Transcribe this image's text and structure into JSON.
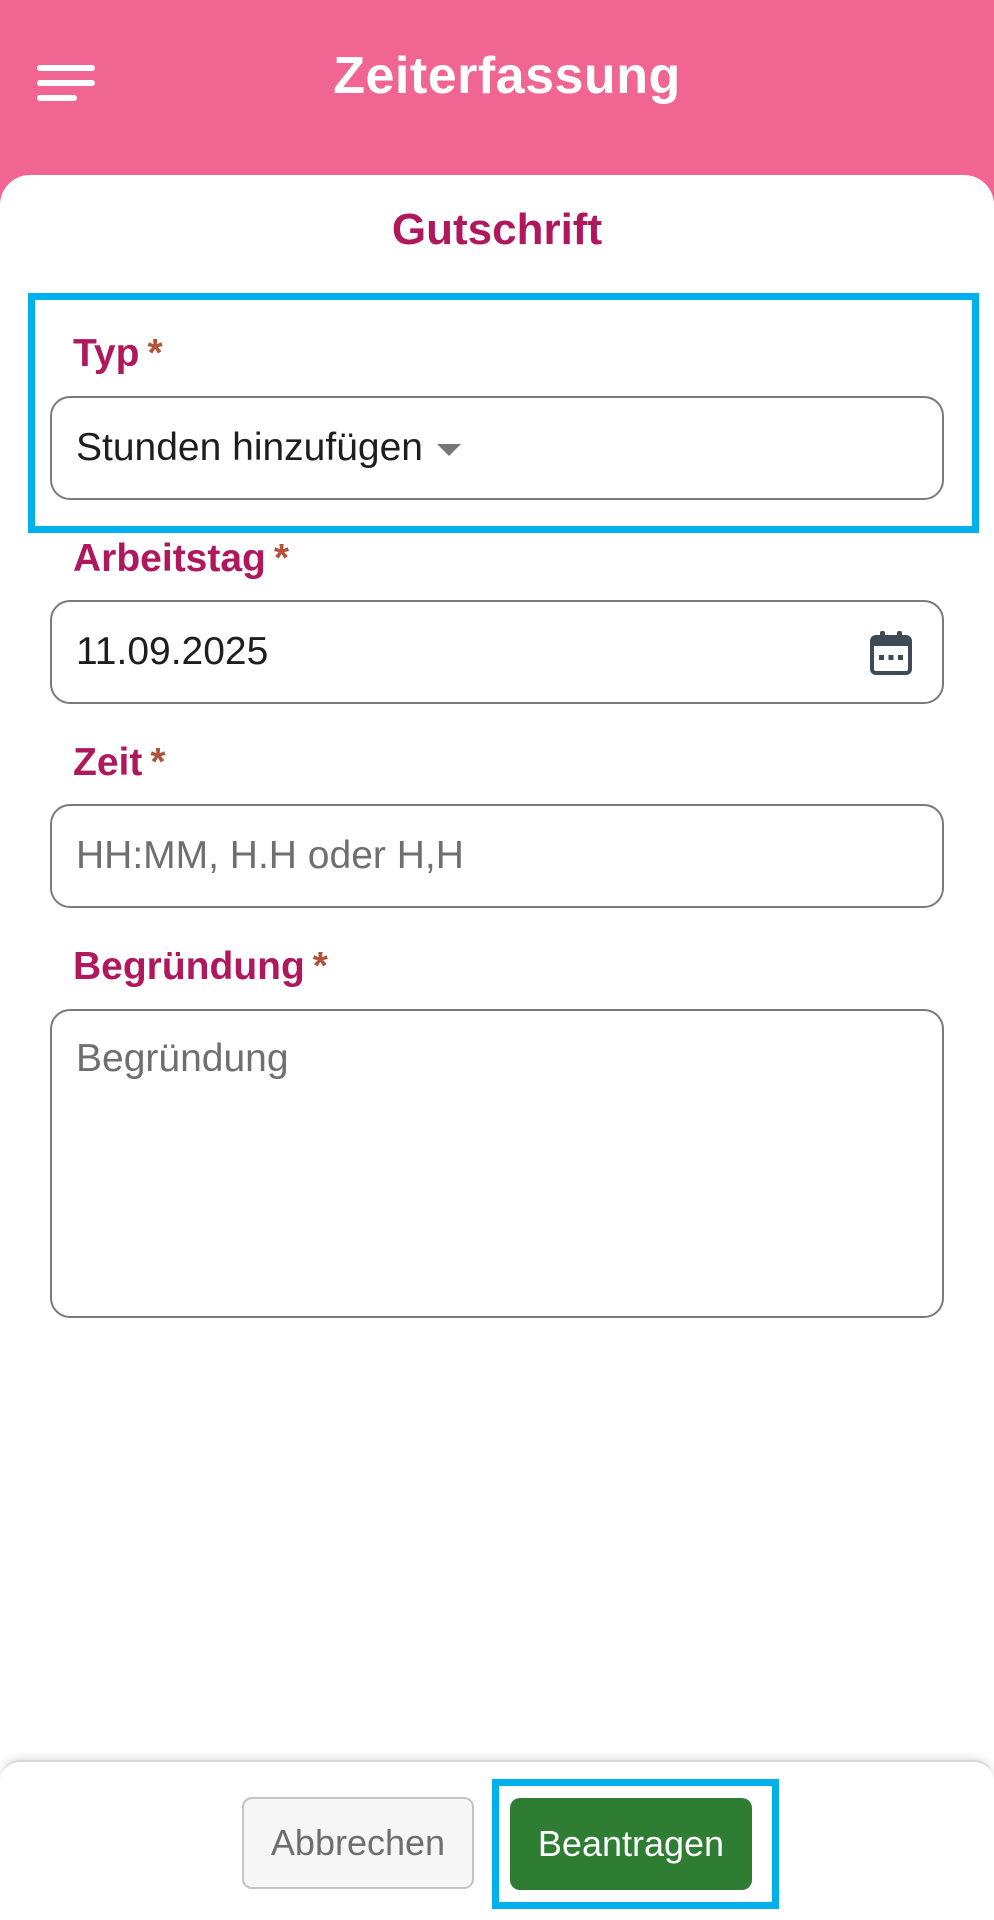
{
  "app_bar": {
    "title": "Zeiterfassung",
    "menu_icon": "hamburger-menu-icon",
    "background_color": "#f06592"
  },
  "form": {
    "heading": "Gutschrift",
    "required_marker": "*",
    "fields": {
      "typ": {
        "label": "Typ",
        "value": "Stunden hinzufügen"
      },
      "arbeitstag": {
        "label": "Arbeitstag",
        "value": "11.09.2025",
        "icon": "calendar-icon"
      },
      "zeit": {
        "label": "Zeit",
        "value": "",
        "placeholder": "HH:MM, H.H oder H,H"
      },
      "begruendung": {
        "label": "Begründung",
        "value": "",
        "placeholder": "Begründung"
      }
    },
    "label_color": "#b0185e",
    "required_color": "#b0533a"
  },
  "footer": {
    "cancel_label": "Abbrechen",
    "submit_label": "Beantragen",
    "submit_color": "#2e7d32"
  },
  "highlight_color": "#00b0ea"
}
